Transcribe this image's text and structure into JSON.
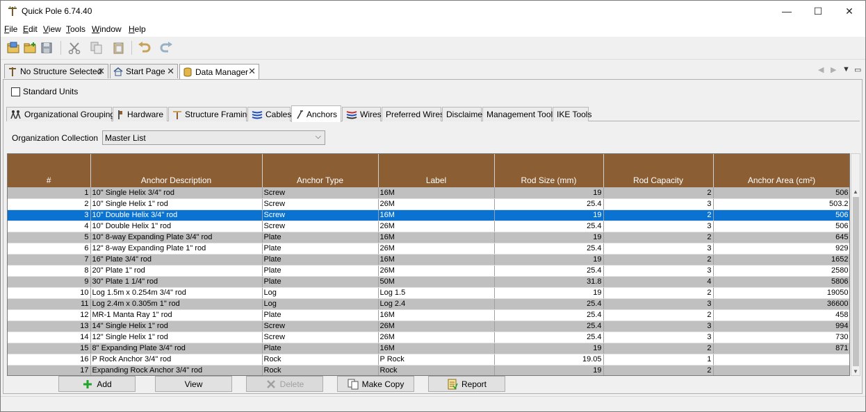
{
  "window": {
    "title": "Quick Pole 6.74.40",
    "minimize_glyph": "—",
    "maximize_glyph": "☐",
    "close_glyph": "✕"
  },
  "menu": [
    {
      "label": "File",
      "accel": "F",
      "rest": "ile"
    },
    {
      "label": "Edit",
      "accel": "E",
      "rest": "dit"
    },
    {
      "label": "View",
      "accel": "V",
      "rest": "iew"
    },
    {
      "label": "Tools",
      "accel": "T",
      "rest": "ools"
    },
    {
      "label": "Window",
      "accel": "W",
      "rest": "indow"
    },
    {
      "label": "Help",
      "accel": "H",
      "rest": "elp"
    }
  ],
  "toolbar": {
    "icons": [
      "open-folder-icon",
      "new-folder-icon",
      "save-icon",
      "cut-icon",
      "copy-icon",
      "paste-icon",
      "undo-icon",
      "redo-icon"
    ]
  },
  "doc_tabs": [
    {
      "label": "No Structure Selected",
      "icon": "pole-icon",
      "active": false
    },
    {
      "label": "Start Page",
      "icon": "home-icon",
      "active": false
    },
    {
      "label": "Data Manager",
      "icon": "database-icon",
      "active": true
    }
  ],
  "doc_tab_close_glyph": "✕",
  "standard_units": {
    "label": "Standard Units",
    "checked": false
  },
  "sub_tabs": [
    {
      "label": "Organizational Groupings",
      "icon": "people-icon"
    },
    {
      "label": "Hardware",
      "icon": "hardware-icon"
    },
    {
      "label": "Structure Framing",
      "icon": "framing-icon"
    },
    {
      "label": "Cables",
      "icon": "cables-icon"
    },
    {
      "label": "Anchors",
      "icon": "anchor-icon",
      "active": true
    },
    {
      "label": "Wires",
      "icon": "wires-icon"
    },
    {
      "label": "Preferred Wires",
      "icon": ""
    },
    {
      "label": "Disclaimer",
      "icon": ""
    },
    {
      "label": "Management Tools",
      "icon": ""
    },
    {
      "label": "IKE Tools",
      "icon": ""
    }
  ],
  "organization": {
    "label": "Organization Collection",
    "selected": "Master List"
  },
  "table": {
    "columns": [
      "#",
      "Anchor Description",
      "Anchor Type",
      "Label",
      "Rod Size (mm)",
      "Rod Capacity",
      "Anchor Area (cm²)"
    ],
    "selected_row": 3,
    "rows": [
      [
        "1",
        "10\" Single Helix 3/4\" rod",
        "Screw",
        "16M",
        "19",
        "2",
        "506"
      ],
      [
        "2",
        "10\" Single Helix 1\" rod",
        "Screw",
        "26M",
        "25.4",
        "3",
        "503.2"
      ],
      [
        "3",
        "10\" Double Helix 3/4\" rod",
        "Screw",
        "16M",
        "19",
        "2",
        "506"
      ],
      [
        "4",
        "10\" Double Helix 1\" rod",
        "Screw",
        "26M",
        "25.4",
        "3",
        "506"
      ],
      [
        "5",
        "10\" 8-way Expanding Plate 3/4\" rod",
        "Plate",
        "16M",
        "19",
        "2",
        "645"
      ],
      [
        "6",
        "12\" 8-way Expanding Plate 1\" rod",
        "Plate",
        "26M",
        "25.4",
        "3",
        "929"
      ],
      [
        "7",
        "16\" Plate 3/4\" rod",
        "Plate",
        "16M",
        "19",
        "2",
        "1652"
      ],
      [
        "8",
        "20\" Plate 1\" rod",
        "Plate",
        "26M",
        "25.4",
        "3",
        "2580"
      ],
      [
        "9",
        "30\" Plate 1 1/4\" rod",
        "Plate",
        "50M",
        "31.8",
        "4",
        "5806"
      ],
      [
        "10",
        "Log 1.5m x 0.254m 3/4\" rod",
        "Log",
        "Log 1.5",
        "19",
        "2",
        "19050"
      ],
      [
        "11",
        "Log 2.4m x 0.305m 1\" rod",
        "Log",
        "Log 2.4",
        "25.4",
        "3",
        "36600"
      ],
      [
        "12",
        "MR-1 Manta Ray 1\" rod",
        "Plate",
        "16M",
        "25.4",
        "2",
        "458"
      ],
      [
        "13",
        "14\" Single Helix 1\" rod",
        "Screw",
        "26M",
        "25.4",
        "3",
        "994"
      ],
      [
        "14",
        "12\" Single Helix 1\" rod",
        "Screw",
        "26M",
        "25.4",
        "3",
        "730"
      ],
      [
        "15",
        "8\" Expanding Plate 3/4\" rod",
        "Plate",
        "16M",
        "19",
        "2",
        "871"
      ],
      [
        "16",
        "P Rock Anchor 3/4\" rod",
        "Rock",
        "P Rock",
        "19.05",
        "1",
        ""
      ],
      [
        "17",
        "Expanding Rock Anchor 3/4\" rod",
        "Rock",
        "Rock",
        "19",
        "2",
        ""
      ]
    ]
  },
  "buttons": [
    {
      "label": "Add",
      "icon": "plus-icon",
      "enabled": true
    },
    {
      "label": "View",
      "icon": "",
      "enabled": true
    },
    {
      "label": "Delete",
      "icon": "x-icon",
      "enabled": false
    },
    {
      "label": "Make Copy",
      "icon": "copy-docs-icon",
      "enabled": true
    },
    {
      "label": "Report",
      "icon": "report-icon",
      "enabled": true
    }
  ],
  "colors": {
    "header_bg": "#8b5e34",
    "row_alt": "#c0c0c0",
    "selection": "#0a73d2"
  }
}
